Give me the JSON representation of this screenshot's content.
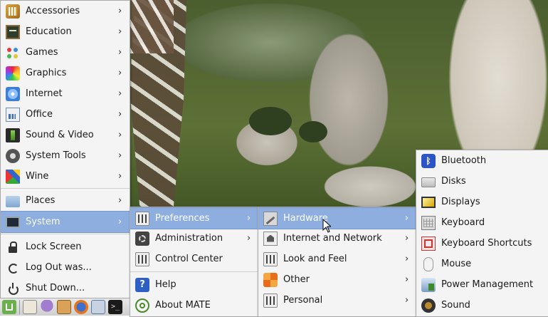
{
  "main_menu": {
    "items": [
      {
        "label": "Accessories",
        "icon": "accessories-icon"
      },
      {
        "label": "Education",
        "icon": "education-icon"
      },
      {
        "label": "Games",
        "icon": "games-icon"
      },
      {
        "label": "Graphics",
        "icon": "graphics-icon"
      },
      {
        "label": "Internet",
        "icon": "internet-icon"
      },
      {
        "label": "Office",
        "icon": "office-icon"
      },
      {
        "label": "Sound & Video",
        "icon": "sound-video-icon"
      },
      {
        "label": "System Tools",
        "icon": "system-tools-icon"
      },
      {
        "label": "Wine",
        "icon": "wine-icon"
      }
    ],
    "places": "Places",
    "system": "System",
    "actions": [
      "Lock Screen",
      "Log Out was...",
      "Shut Down..."
    ]
  },
  "system_menu": {
    "items": [
      "Preferences",
      "Administration",
      "Control Center"
    ],
    "help": "Help",
    "about": "About MATE"
  },
  "preferences_menu": {
    "items": [
      "Hardware",
      "Internet and Network",
      "Look and Feel",
      "Other",
      "Personal"
    ]
  },
  "hardware_menu": {
    "items": [
      "Bluetooth",
      "Disks",
      "Displays",
      "Keyboard",
      "Keyboard Shortcuts",
      "Mouse",
      "Power Management",
      "Sound"
    ]
  },
  "panel": {
    "terminal_glyph": ">_"
  },
  "colors": {
    "selection": "#8eaee0",
    "menu_bg": "#f4f4f4"
  }
}
